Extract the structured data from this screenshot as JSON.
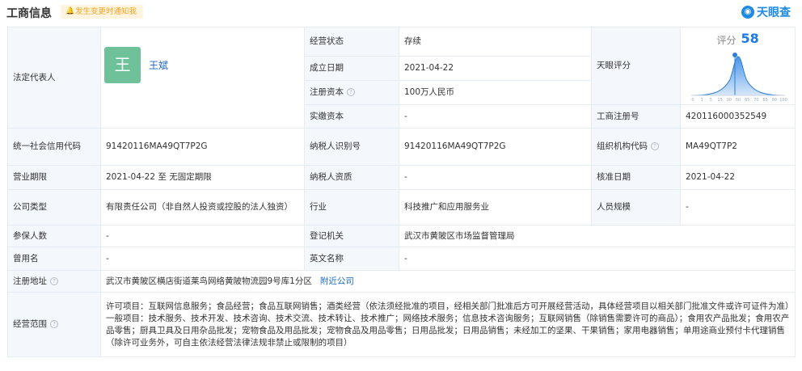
{
  "header": {
    "title": "工商信息",
    "notify_label": "发生变更时通知我",
    "brand": "天眼查"
  },
  "legal_rep": {
    "label": "法定代表人",
    "avatar_char": "王",
    "name": "王斌"
  },
  "status": {
    "label": "经营状态",
    "value": "存续"
  },
  "founded": {
    "label": "成立日期",
    "value": "2021-04-22"
  },
  "reg_capital": {
    "label": "注册资本",
    "value": "100万人民币"
  },
  "paid_capital": {
    "label": "实缴资本",
    "value": "-"
  },
  "score": {
    "label": "天眼评分",
    "title": "评分",
    "value": "58",
    "axis_ticks": [
      "0",
      "1",
      "5",
      "15",
      "30",
      "50",
      "65",
      "70",
      "85",
      "90",
      "100"
    ]
  },
  "reg_no": {
    "label": "工商注册号",
    "value": "420116000352549"
  },
  "credit_code": {
    "label": "统一社会信用代码",
    "value": "91420116MA49QT7P2G"
  },
  "taxpayer_id": {
    "label": "纳税人识别号",
    "value": "91420116MA49QT7P2G"
  },
  "org_code": {
    "label": "组织机构代码",
    "value": "MA49QT7P2"
  },
  "term": {
    "label": "营业期限",
    "value": "2021-04-22 至 无固定期限"
  },
  "taxpayer_qual": {
    "label": "纳税人资质",
    "value": "-"
  },
  "approved": {
    "label": "核准日期",
    "value": "2021-04-22"
  },
  "company_type": {
    "label": "公司类型",
    "value": "有限责任公司（非自然人投资或控股的法人独资）"
  },
  "industry": {
    "label": "行业",
    "value": "科技推广和应用服务业"
  },
  "staff": {
    "label": "人员规模",
    "value": "-"
  },
  "insured": {
    "label": "参保人数",
    "value": "-"
  },
  "authority": {
    "label": "登记机关",
    "value": "武汉市黄陂区市场监督管理局"
  },
  "former_name": {
    "label": "曾用名",
    "value": "-"
  },
  "english_name": {
    "label": "英文名称",
    "value": "-"
  },
  "address": {
    "label": "注册地址",
    "value": "武汉市黄陂区横店街道莱鸟网络黄陂物流园9号库1分区",
    "nearby_link": "附近公司"
  },
  "scope": {
    "label": "经营范围",
    "value": "许可项目：互联网信息服务；食品经营；食品互联网销售；酒类经营（依法须经批准的项目，经相关部门批准后方可开展经营活动，具体经营项目以相关部门批准文件或许可证件为准）一般项目：技术服务、技术开发、技术咨询、技术交流、技术转让、技术推广；网络技术服务；信息技术咨询服务；互联网销售（除销售需要许可的商品）；食用农产品批发；食用农产品零售；厨具卫具及日用杂品批发；宠物食品及用品批发；宠物食品及用品零售；日用品批发；日用品销售；未经加工的坚果、干果销售；家用电器销售；单用途商业预付卡代理销售（除许可业务外，可自主依法经营法律法规非禁止或限制的项目）"
  },
  "colors": {
    "label_bg": "#f4f7fc",
    "border": "#e6ecf5",
    "link": "#1a66c4",
    "score": "#1a7be0",
    "notify_bg": "#fff4e0",
    "notify_text": "#f5a623",
    "avatar_bg": "#6fc19a"
  }
}
